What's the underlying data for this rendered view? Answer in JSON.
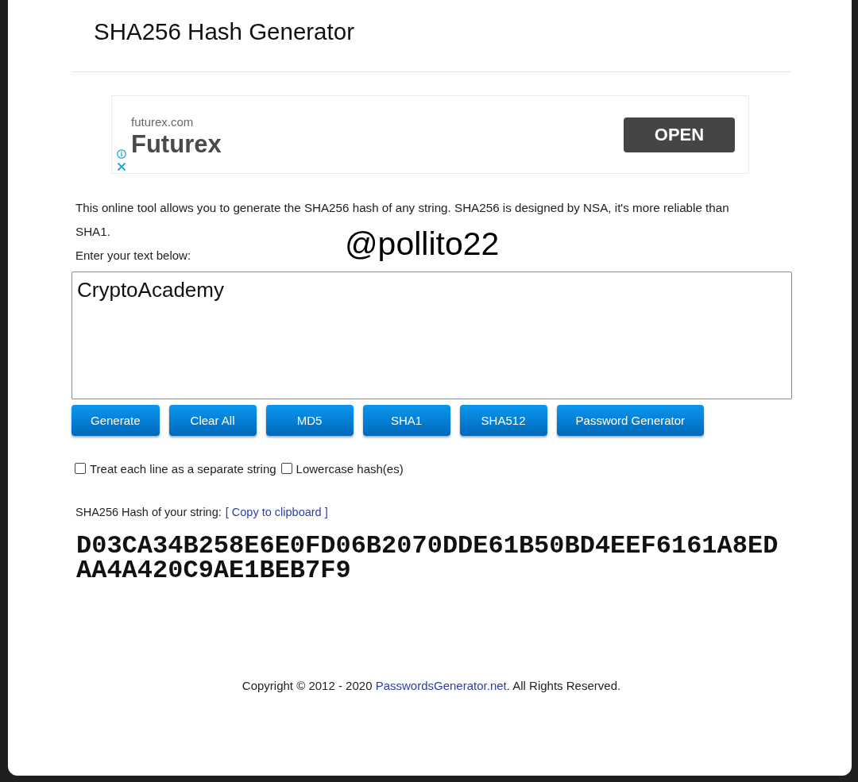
{
  "page": {
    "title": "SHA256 Hash Generator"
  },
  "ad": {
    "domain": "futurex.com",
    "brand": "Futurex",
    "button": "OPEN"
  },
  "intro": {
    "description": "This online tool allows you to generate the SHA256 hash of any string. SHA256 is designed by NSA, it's more reliable than SHA1.",
    "prompt": "Enter your text below:"
  },
  "overlay_text": "@pollito22",
  "input": {
    "value": "CryptoAcademy"
  },
  "buttons": [
    "Generate",
    "Clear All",
    "MD5",
    "SHA1",
    "SHA512",
    "Password Generator"
  ],
  "options": [
    {
      "label": "Treat each line as a separate string",
      "checked": false
    },
    {
      "label": "Lowercase hash(es)",
      "checked": false
    }
  ],
  "result": {
    "label": "SHA256 Hash of your string:",
    "copy_link": "[ Copy to clipboard ]",
    "hash": "D03CA34B258E6E0FD06B2070DDE61B50BD4EEF6161A8EDAA4A420C9AE1BEB7F9"
  },
  "footer": {
    "before": "Copyright © 2012 - 2020 ",
    "link": "PasswordsGenerator.net",
    "after": ". All Rights Reserved."
  }
}
